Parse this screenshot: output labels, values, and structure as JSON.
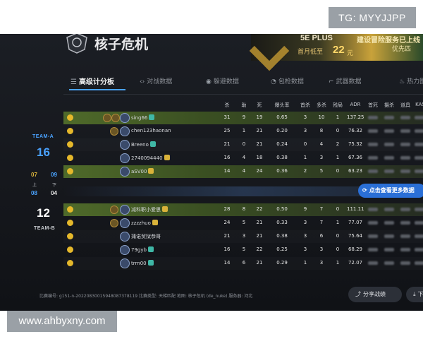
{
  "watermarks": {
    "top": "TG: MYYJJPP",
    "bottom": "www.ahbyxny.com"
  },
  "header": {
    "map_title": "核子危机",
    "logo_icon": "team-emblem-icon",
    "ad": {
      "brand": "5E PLUS",
      "small": "首月低至",
      "price": "22",
      "unit": "元",
      "extra": "建设冒险服务已上线",
      "extra2": "优先匹"
    }
  },
  "tabs": [
    {
      "label": "高级计分板",
      "icon": "list-icon",
      "active": true
    },
    {
      "label": "对战数据",
      "icon": "versus-icon",
      "active": false
    },
    {
      "label": "躲避数据",
      "icon": "target-icon",
      "active": false
    },
    {
      "label": "包枪数据",
      "icon": "gun-icon",
      "active": false
    },
    {
      "label": "武器数据",
      "icon": "rifle-icon",
      "active": false
    },
    {
      "label": "热力图",
      "icon": "fire-icon",
      "active": false
    }
  ],
  "columns": [
    "杀",
    "助",
    "死",
    "爆头率",
    "首杀",
    "多杀",
    "残局",
    "ADR",
    "首死",
    "摄杀",
    "道具",
    "KAS"
  ],
  "team_a": {
    "label": "TEAM-A",
    "score": "16",
    "color": "#4aa3ff",
    "players": [
      {
        "name": "sing66",
        "level": "teal",
        "k": "31",
        "a": "9",
        "d": "19",
        "hs": "0.65",
        "fk": "3",
        "mk": "10",
        "cl": "1",
        "adr": "137.25",
        "highlight": true
      },
      {
        "name": "chen123haonan",
        "level": "none",
        "k": "25",
        "a": "1",
        "d": "21",
        "hs": "0.20",
        "fk": "3",
        "mk": "8",
        "cl": "0",
        "adr": "76.32",
        "highlight": false
      },
      {
        "name": "Breeno",
        "level": "teal",
        "k": "21",
        "a": "0",
        "d": "21",
        "hs": "0.24",
        "fk": "0",
        "mk": "4",
        "cl": "2",
        "adr": "75.32",
        "highlight": false
      },
      {
        "name": "2740094440",
        "level": "gold",
        "k": "16",
        "a": "4",
        "d": "18",
        "hs": "0.38",
        "fk": "1",
        "mk": "3",
        "cl": "1",
        "adr": "67.36",
        "highlight": false
      },
      {
        "name": "aSV00",
        "level": "gold",
        "k": "14",
        "a": "4",
        "d": "24",
        "hs": "0.36",
        "fk": "2",
        "mk": "5",
        "cl": "0",
        "adr": "63.23",
        "highlight": true
      }
    ]
  },
  "team_b": {
    "label": "TEAM-B",
    "score": "12",
    "color": "#ffffff",
    "players": [
      {
        "name": "减科职小爱思",
        "level": "gold",
        "k": "28",
        "a": "8",
        "d": "22",
        "hs": "0.50",
        "fk": "9",
        "mk": "7",
        "cl": "0",
        "adr": "111.11",
        "highlight": true
      },
      {
        "name": "zzzzhuo",
        "level": "gold",
        "k": "24",
        "a": "5",
        "d": "21",
        "hs": "0.33",
        "fk": "3",
        "mk": "7",
        "cl": "1",
        "adr": "77.07",
        "highlight": false
      },
      {
        "name": "蒲诺贸狱恭哥",
        "level": "none",
        "k": "21",
        "a": "3",
        "d": "21",
        "hs": "0.38",
        "fk": "3",
        "mk": "6",
        "cl": "0",
        "adr": "75.64",
        "highlight": false
      },
      {
        "name": "79gyb",
        "level": "teal",
        "k": "16",
        "a": "5",
        "d": "22",
        "hs": "0.25",
        "fk": "3",
        "mk": "3",
        "cl": "0",
        "adr": "68.29",
        "highlight": false
      },
      {
        "name": "trrn00",
        "level": "teal",
        "k": "14",
        "a": "6",
        "d": "21",
        "hs": "0.29",
        "fk": "1",
        "mk": "3",
        "cl": "1",
        "adr": "72.07",
        "highlight": false
      }
    ]
  },
  "halves": {
    "a_first": "07",
    "a_second": "09",
    "b_first": "08",
    "b_second": "04",
    "up": "上",
    "down": "下"
  },
  "view_more": "点击查看更多数据",
  "footer": "比赛编号: g151-n-20220830015948087378119  比赛类型: 天梯匹配  地图: 核子危机 (de_nuke)  服务器: 河北",
  "buttons": {
    "share": "分享战绩",
    "download": "下载"
  }
}
